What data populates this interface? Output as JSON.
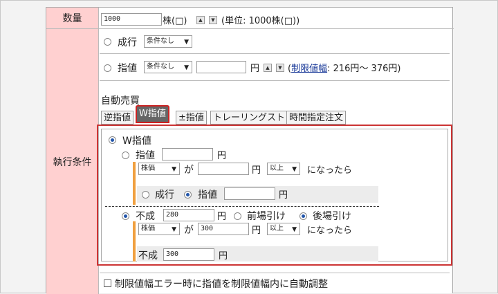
{
  "labels": {
    "quantity": "数量",
    "execution": "執行条件"
  },
  "quantity": {
    "value": "1000",
    "unit": "株(□)",
    "unit_info": "(単位: 1000株(□))"
  },
  "market": {
    "label": "成行",
    "condition": "条件なし"
  },
  "limit": {
    "label": "指値",
    "condition": "条件なし",
    "price": "",
    "yen": "円",
    "range_link": "制限値幅",
    "range_text": ": 216円～ 376円)",
    "paren_open": "("
  },
  "auto_trade": {
    "heading": "自動売買",
    "tabs": [
      "逆指値",
      "W指値",
      "±指値",
      "トレーリングストップ",
      "時間指定注文"
    ]
  },
  "w": {
    "title": "W指値",
    "limit_label": "指値",
    "limit_price": "",
    "yen": "円",
    "cond1": {
      "basis": "株価",
      "ga": "が",
      "price": "",
      "yen": "円",
      "cmp": "以上",
      "suffix": "になったら"
    },
    "after": {
      "market": "成行",
      "limit": "指値",
      "price": "",
      "yen": "円"
    },
    "funari_label": "不成",
    "funari_price": "280",
    "zenba": "前場引け",
    "goba": "後場引け",
    "cond2": {
      "basis": "株価",
      "ga": "が",
      "price": "300",
      "yen": "円",
      "cmp": "以上",
      "suffix": "になったら"
    },
    "after2": {
      "label": "不成",
      "price": "300",
      "yen": "円"
    }
  },
  "footer_check": "制限値幅エラー時に指値を制限値幅内に自動調整"
}
